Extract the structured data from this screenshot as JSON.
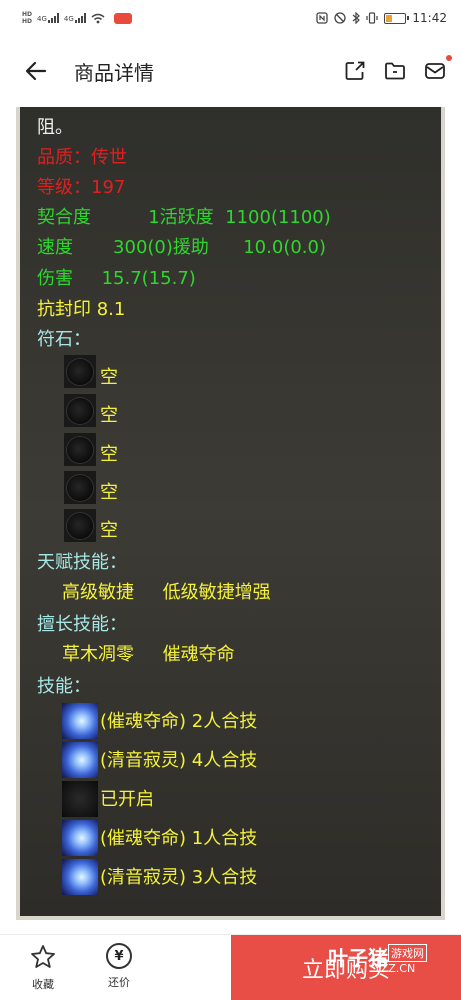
{
  "status_bar": {
    "hd_top": "HD",
    "hd_bottom": "HD",
    "sig1": "4G",
    "sig2": "4G",
    "time": "11:42"
  },
  "header": {
    "title": "商品详情"
  },
  "panel": {
    "line_intro": "阻。",
    "line_quality": "品质：传世",
    "line_level": "等级：197",
    "line_bond": "契合度          1活跃度  1100(1100)",
    "line_speed": "速度       300(0)援助      10.0(0.0)",
    "line_damage": "伤害     15.7(15.7)",
    "line_resist": "抗封印 8.1",
    "runes_header": "符石：",
    "runes": [
      "空",
      "空",
      "空",
      "空",
      "空"
    ],
    "talent_header": "天赋技能：",
    "talent_line": "高级敏捷     低级敏捷增强",
    "specialty_header": "擅长技能：",
    "specialty_line": "草木凋零     催魂夺命",
    "skills_header": "技能：",
    "skills": [
      "(催魂夺命) 2人合技",
      "(清音寂灵) 4人合技",
      "已开启",
      "(催魂夺命) 1人合技",
      "(清音寂灵) 3人合技"
    ]
  },
  "bottom_bar": {
    "favorite_label": "收藏",
    "bargain_label": "还价",
    "bargain_icon_glyph": "¥",
    "buy_label": "立即购买",
    "watermark_main": "叶子猪",
    "watermark_tag": "游戏网",
    "watermark_url": "YZZ.CN"
  },
  "colors": {
    "buy_button": "#e84d46",
    "quality_red": "#e02020",
    "stat_green": "#2ed62e",
    "text_yellow": "#f4f23a",
    "header_cyan": "#a7e8e6"
  }
}
